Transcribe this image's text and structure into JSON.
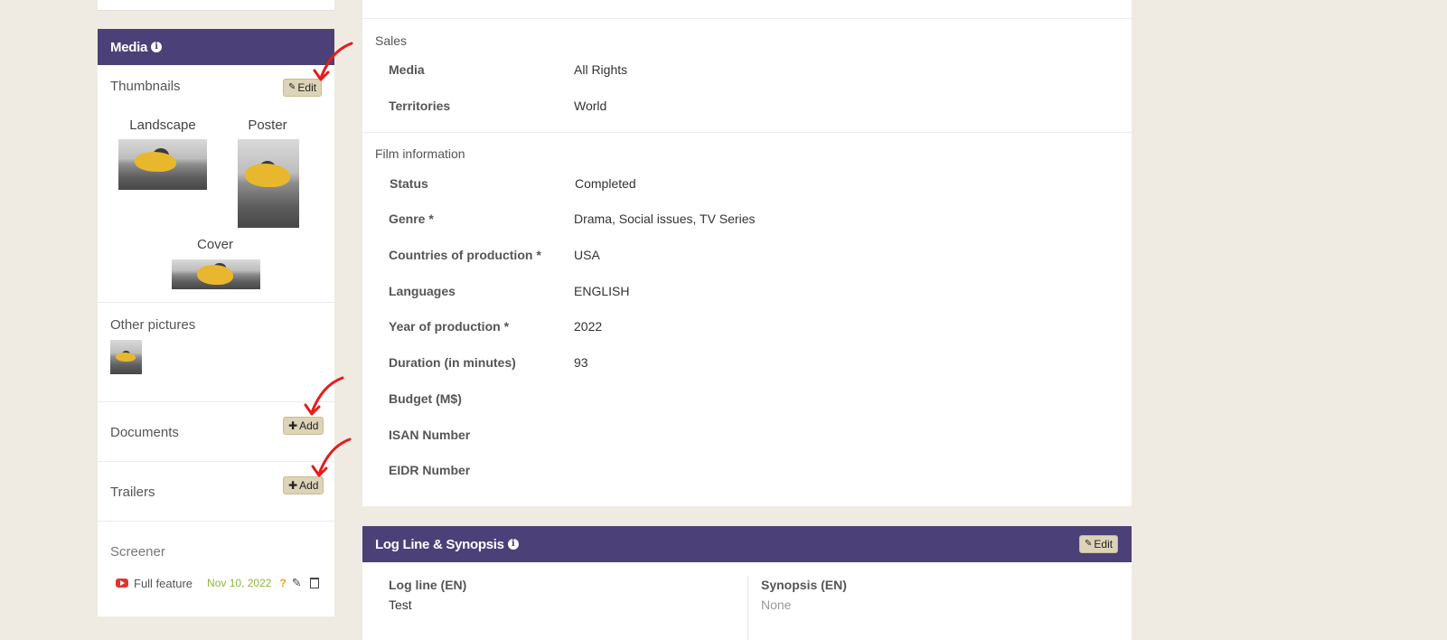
{
  "media": {
    "title": "Media",
    "thumbnails": {
      "title": "Thumbnails",
      "edit_label": "Edit",
      "landscape_label": "Landscape",
      "poster_label": "Poster",
      "cover_label": "Cover"
    },
    "other_pictures": {
      "title": "Other pictures"
    },
    "documents": {
      "title": "Documents",
      "add_label": "Add"
    },
    "trailers": {
      "title": "Trailers",
      "add_label": "Add"
    },
    "screener": {
      "title": "Screener",
      "item_label": "Full feature",
      "date": "Nov 10, 2022",
      "status_icon": "?"
    }
  },
  "sales": {
    "title": "Sales",
    "rows": [
      {
        "label": "Media",
        "value": "All Rights"
      },
      {
        "label": "Territories",
        "value": "World"
      }
    ]
  },
  "film_info": {
    "title": "Film information",
    "rows": [
      {
        "label": "Status",
        "value": "Completed"
      },
      {
        "label": "Genre *",
        "value": "Drama, Social issues, TV Series"
      },
      {
        "label": "Countries of production *",
        "value": "USA"
      },
      {
        "label": "Languages",
        "value": "ENGLISH"
      },
      {
        "label": "Year of production *",
        "value": "2022"
      },
      {
        "label": "Duration (in minutes)",
        "value": "93"
      },
      {
        "label": "Budget (M$)",
        "value": ""
      },
      {
        "label": "ISAN Number",
        "value": ""
      },
      {
        "label": "EIDR Number",
        "value": ""
      }
    ]
  },
  "logline_synopsis": {
    "title": "Log Line & Synopsis",
    "edit_label": "Edit",
    "logline_label": "Log line (EN)",
    "logline_value": "Test",
    "synopsis_label": "Synopsis (EN)",
    "synopsis_value": "None"
  },
  "colors": {
    "header_purple": "#4b4077",
    "button_bg": "#ddd3b8",
    "page_bg": "#efebe2",
    "date_green": "#8db63d",
    "status_orange": "#e8a317",
    "annotation_red": "#e81b1b"
  }
}
